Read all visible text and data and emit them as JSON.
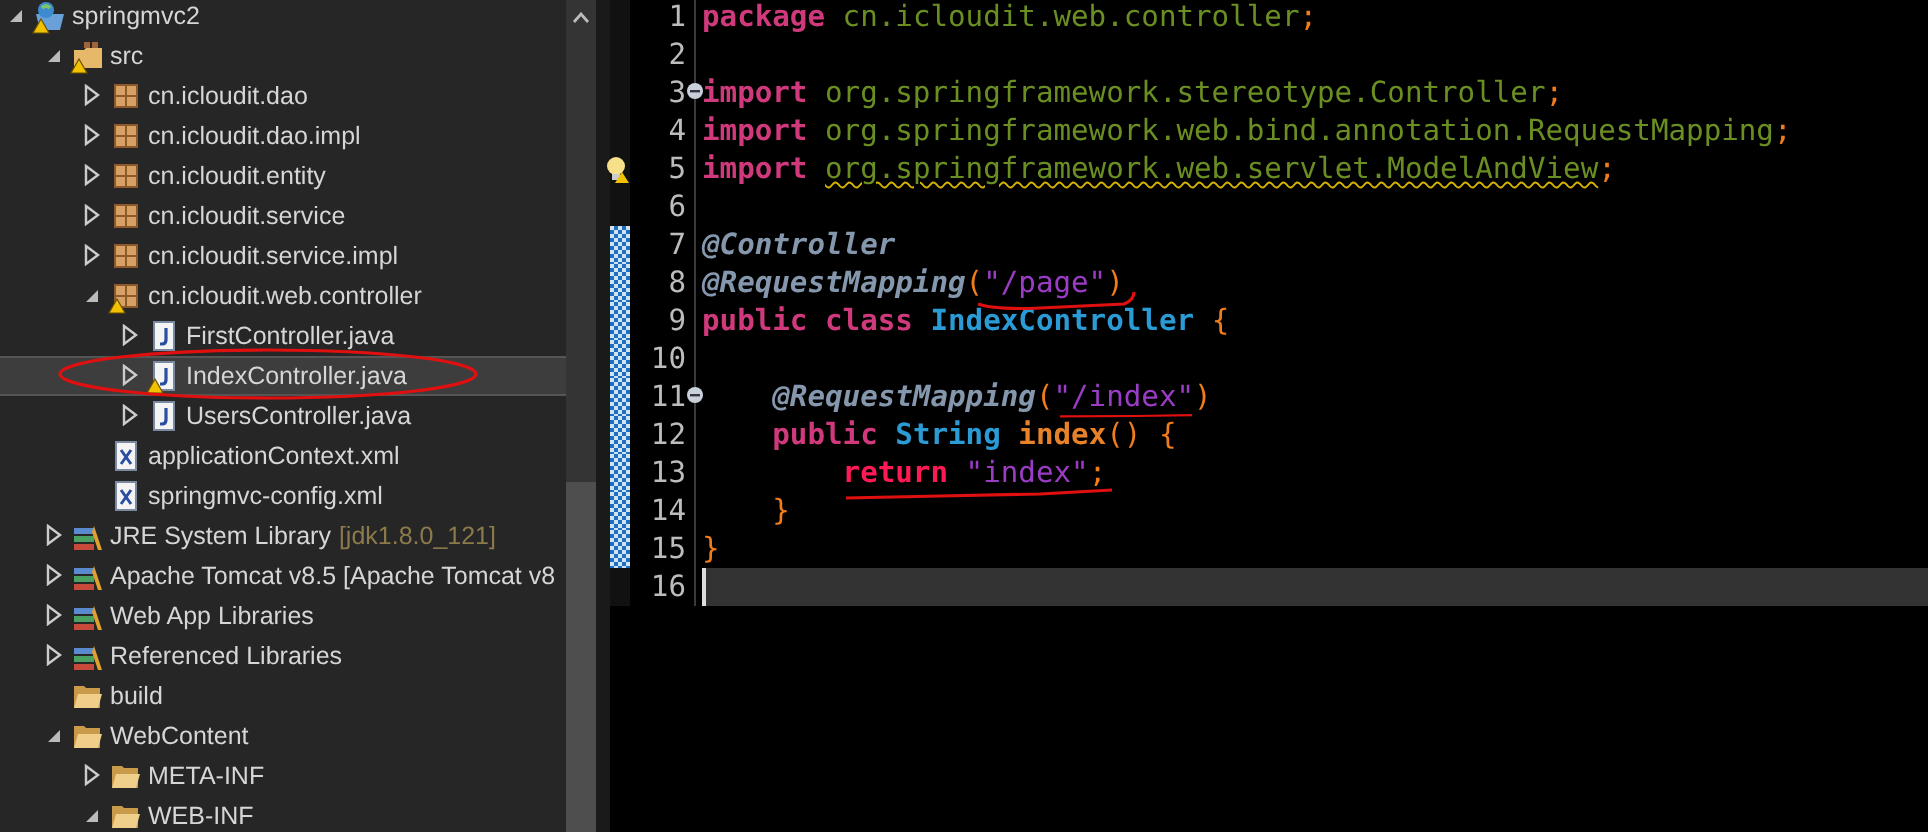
{
  "explorer": {
    "tree": [
      {
        "label": "springmvc2",
        "kind": "project",
        "expandable": true,
        "expanded": true,
        "warning": true,
        "selected": false,
        "children": [
          {
            "label": "src",
            "kind": "source-folder",
            "expandable": true,
            "expanded": true,
            "warning": true,
            "selected": false,
            "children": [
              {
                "label": "cn.icloudit.dao",
                "kind": "package",
                "expandable": true,
                "expanded": false,
                "warning": false,
                "selected": false
              },
              {
                "label": "cn.icloudit.dao.impl",
                "kind": "package",
                "expandable": true,
                "expanded": false,
                "warning": false,
                "selected": false
              },
              {
                "label": "cn.icloudit.entity",
                "kind": "package",
                "expandable": true,
                "expanded": false,
                "warning": false,
                "selected": false
              },
              {
                "label": "cn.icloudit.service",
                "kind": "package",
                "expandable": true,
                "expanded": false,
                "warning": false,
                "selected": false
              },
              {
                "label": "cn.icloudit.service.impl",
                "kind": "package",
                "expandable": true,
                "expanded": false,
                "warning": false,
                "selected": false
              },
              {
                "label": "cn.icloudit.web.controller",
                "kind": "package",
                "expandable": true,
                "expanded": true,
                "warning": true,
                "selected": false,
                "children": [
                  {
                    "label": "FirstController.java",
                    "kind": "java",
                    "expandable": true,
                    "expanded": false,
                    "warning": false,
                    "selected": false
                  },
                  {
                    "label": "IndexController.java",
                    "kind": "java",
                    "expandable": true,
                    "expanded": false,
                    "warning": true,
                    "selected": true
                  },
                  {
                    "label": "UsersController.java",
                    "kind": "java",
                    "expandable": true,
                    "expanded": false,
                    "warning": false,
                    "selected": false
                  }
                ]
              },
              {
                "label": "applicationContext.xml",
                "kind": "xml",
                "expandable": false,
                "warning": false,
                "selected": false
              },
              {
                "label": "springmvc-config.xml",
                "kind": "xml",
                "expandable": false,
                "warning": false,
                "selected": false
              }
            ]
          },
          {
            "label": "JRE System Library",
            "decoration": "[jdk1.8.0_121]",
            "kind": "library",
            "expandable": true,
            "expanded": false,
            "warning": false,
            "selected": false
          },
          {
            "label": "Apache Tomcat v8.5 [Apache Tomcat v8",
            "kind": "library",
            "expandable": true,
            "expanded": false,
            "warning": false,
            "selected": false
          },
          {
            "label": "Web App Libraries",
            "kind": "library",
            "expandable": true,
            "expanded": false,
            "warning": false,
            "selected": false
          },
          {
            "label": "Referenced Libraries",
            "kind": "library",
            "expandable": true,
            "expanded": false,
            "warning": false,
            "selected": false
          },
          {
            "label": "build",
            "kind": "folder",
            "expandable": false,
            "warning": false,
            "selected": false
          },
          {
            "label": "WebContent",
            "kind": "folder",
            "expandable": true,
            "expanded": true,
            "warning": false,
            "selected": false,
            "children": [
              {
                "label": "META-INF",
                "kind": "folder",
                "expandable": true,
                "expanded": false,
                "warning": false,
                "selected": false
              },
              {
                "label": "WEB-INF",
                "kind": "folder",
                "expandable": true,
                "expanded": true,
                "warning": false,
                "selected": false
              }
            ]
          }
        ]
      }
    ]
  },
  "editor": {
    "lines": [
      {
        "number": "1",
        "fold": false,
        "warning": false,
        "changed": false,
        "current": false,
        "tokens": [
          {
            "text": "package",
            "kind": "keyword"
          },
          {
            "text": " cn.icloudit.web.controller",
            "kind": "package"
          },
          {
            "text": ";",
            "kind": "punct"
          }
        ]
      },
      {
        "number": "2",
        "fold": false,
        "warning": false,
        "changed": false,
        "current": false
      },
      {
        "number": "3",
        "fold": true,
        "warning": false,
        "changed": false,
        "current": false,
        "tokens": [
          {
            "text": "import",
            "kind": "keyword"
          },
          {
            "text": " org.springframework.stereotype.Controller",
            "kind": "package"
          },
          {
            "text": ";",
            "kind": "punct"
          }
        ]
      },
      {
        "number": "4",
        "fold": false,
        "warning": false,
        "changed": false,
        "current": false,
        "tokens": [
          {
            "text": "import",
            "kind": "keyword"
          },
          {
            "text": " org.springframework.web.bind.annotation.RequestMapping",
            "kind": "package"
          },
          {
            "text": ";",
            "kind": "punct"
          }
        ]
      },
      {
        "number": "5",
        "fold": false,
        "warning": true,
        "changed": false,
        "current": false,
        "tokens": [
          {
            "text": "import ",
            "kind": "keyword"
          },
          {
            "text": "org.springframework.web.servlet.ModelAndView",
            "kind": "package"
          },
          {
            "text": ";",
            "kind": "punct"
          }
        ]
      },
      {
        "number": "6",
        "fold": false,
        "warning": false,
        "changed": false,
        "current": false
      },
      {
        "number": "7",
        "fold": false,
        "warning": false,
        "changed": true,
        "current": false,
        "tokens": [
          {
            "text": "@Controller",
            "kind": "annotation"
          }
        ]
      },
      {
        "number": "8",
        "fold": false,
        "warning": false,
        "changed": true,
        "current": false,
        "tokens": [
          {
            "text": "@RequestMapping",
            "kind": "annotation"
          },
          {
            "text": "(",
            "kind": "punct"
          },
          {
            "text": "\"/page\"",
            "kind": "string"
          },
          {
            "text": ")",
            "kind": "punct"
          }
        ]
      },
      {
        "number": "9",
        "fold": false,
        "warning": false,
        "changed": true,
        "current": false,
        "tokens": [
          {
            "text": "public",
            "kind": "keyword"
          },
          {
            "text": " class",
            "kind": "keyword"
          },
          {
            "text": " IndexController",
            "kind": "type"
          },
          {
            "text": " {",
            "kind": "punct"
          }
        ]
      },
      {
        "number": "10",
        "fold": false,
        "warning": false,
        "changed": true,
        "current": false
      },
      {
        "number": "11",
        "fold": true,
        "warning": false,
        "changed": true,
        "current": false,
        "tokens": [
          {
            "text": "    @RequestMapping",
            "kind": "annotation"
          },
          {
            "text": "(",
            "kind": "punct"
          },
          {
            "text": "\"/index\"",
            "kind": "string"
          },
          {
            "text": ")",
            "kind": "punct"
          }
        ]
      },
      {
        "number": "12",
        "fold": false,
        "warning": false,
        "changed": true,
        "current": false,
        "tokens": [
          {
            "text": "    public",
            "kind": "keyword"
          },
          {
            "text": " String",
            "kind": "type"
          },
          {
            "text": " index",
            "kind": "method"
          },
          {
            "text": "()",
            "kind": "punct"
          },
          {
            "text": " {",
            "kind": "punct"
          }
        ]
      },
      {
        "number": "13",
        "fold": false,
        "warning": false,
        "changed": true,
        "current": false,
        "tokens": [
          {
            "text": "        return",
            "kind": "return"
          },
          {
            "text": " \"index\"",
            "kind": "string"
          },
          {
            "text": ";",
            "kind": "punct"
          }
        ]
      },
      {
        "number": "14",
        "fold": false,
        "warning": false,
        "changed": true,
        "current": false,
        "tokens": [
          {
            "text": "    }",
            "kind": "punct"
          }
        ]
      },
      {
        "number": "15",
        "fold": false,
        "warning": false,
        "changed": true,
        "current": false,
        "tokens": [
          {
            "text": "}",
            "kind": "punct"
          }
        ]
      },
      {
        "number": "16",
        "fold": false,
        "warning": false,
        "changed": false,
        "current": true
      }
    ]
  }
}
